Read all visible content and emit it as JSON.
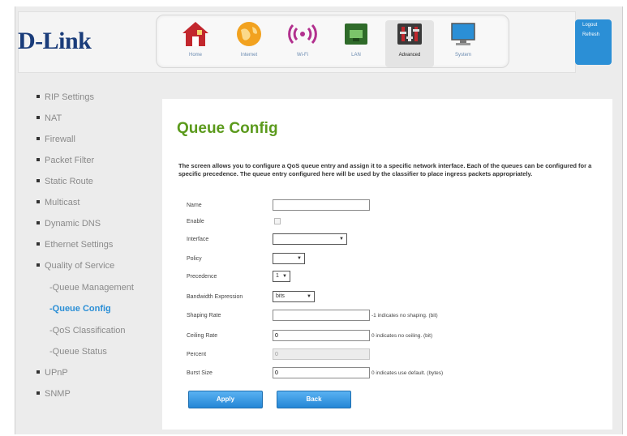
{
  "brand": {
    "logo_text": "D-Link"
  },
  "nav": {
    "items": [
      {
        "label": "Home",
        "icon": "home-icon"
      },
      {
        "label": "Internet",
        "icon": "globe-icon"
      },
      {
        "label": "Wi-Fi",
        "icon": "wifi-icon"
      },
      {
        "label": "LAN",
        "icon": "lan-icon"
      },
      {
        "label": "Advanced",
        "icon": "advanced-icon"
      },
      {
        "label": "System",
        "icon": "system-icon"
      }
    ],
    "active": "Advanced"
  },
  "account": {
    "logout": "Logout",
    "refresh": "Refresh"
  },
  "sidebar": {
    "items": [
      "RIP Settings",
      "NAT",
      "Firewall",
      "Packet Filter",
      "Static Route",
      "Multicast",
      "Dynamic DNS",
      "Ethernet Settings",
      "Quality of Service"
    ],
    "sub_items": [
      "-Queue Management",
      "-Queue Config",
      "-QoS Classification",
      "-Queue Status"
    ],
    "after_items": [
      "UPnP",
      "SNMP"
    ]
  },
  "main": {
    "title": "Queue Config",
    "description": "The screen allows you to configure a QoS queue entry and assign it to a specific network interface. Each of the queues can be configured for a specific precedence. The queue entry configured here will be used by the classifier to place ingress packets appropriately.",
    "fields": {
      "name_label": "Name",
      "name_value": "",
      "enable_label": "Enable",
      "interface_label": "Interface",
      "interface_value": "",
      "policy_label": "Policy",
      "policy_value": "",
      "precedence_label": "Precedence",
      "precedence_value": "1",
      "bandwidth_label": "Bandwidth Expression",
      "bandwidth_value": "bits",
      "shaping_label": "Shaping Rate",
      "shaping_value": "",
      "shaping_hint": "-1 indicates no shaping. (bit)",
      "ceiling_label": "Ceiling Rate",
      "ceiling_value": "0",
      "ceiling_hint": "0 indicates no ceiling. (bit)",
      "percent_label": "Percent",
      "percent_value": "0",
      "burst_label": "Burst Size",
      "burst_value": "0",
      "burst_hint": "0 indicates use default. (bytes)"
    },
    "buttons": {
      "apply": "Apply",
      "back": "Back"
    }
  },
  "colors": {
    "accent": "#2b8fd6",
    "title_green": "#5b9a1c",
    "logo_blue": "#1a3c7a"
  }
}
